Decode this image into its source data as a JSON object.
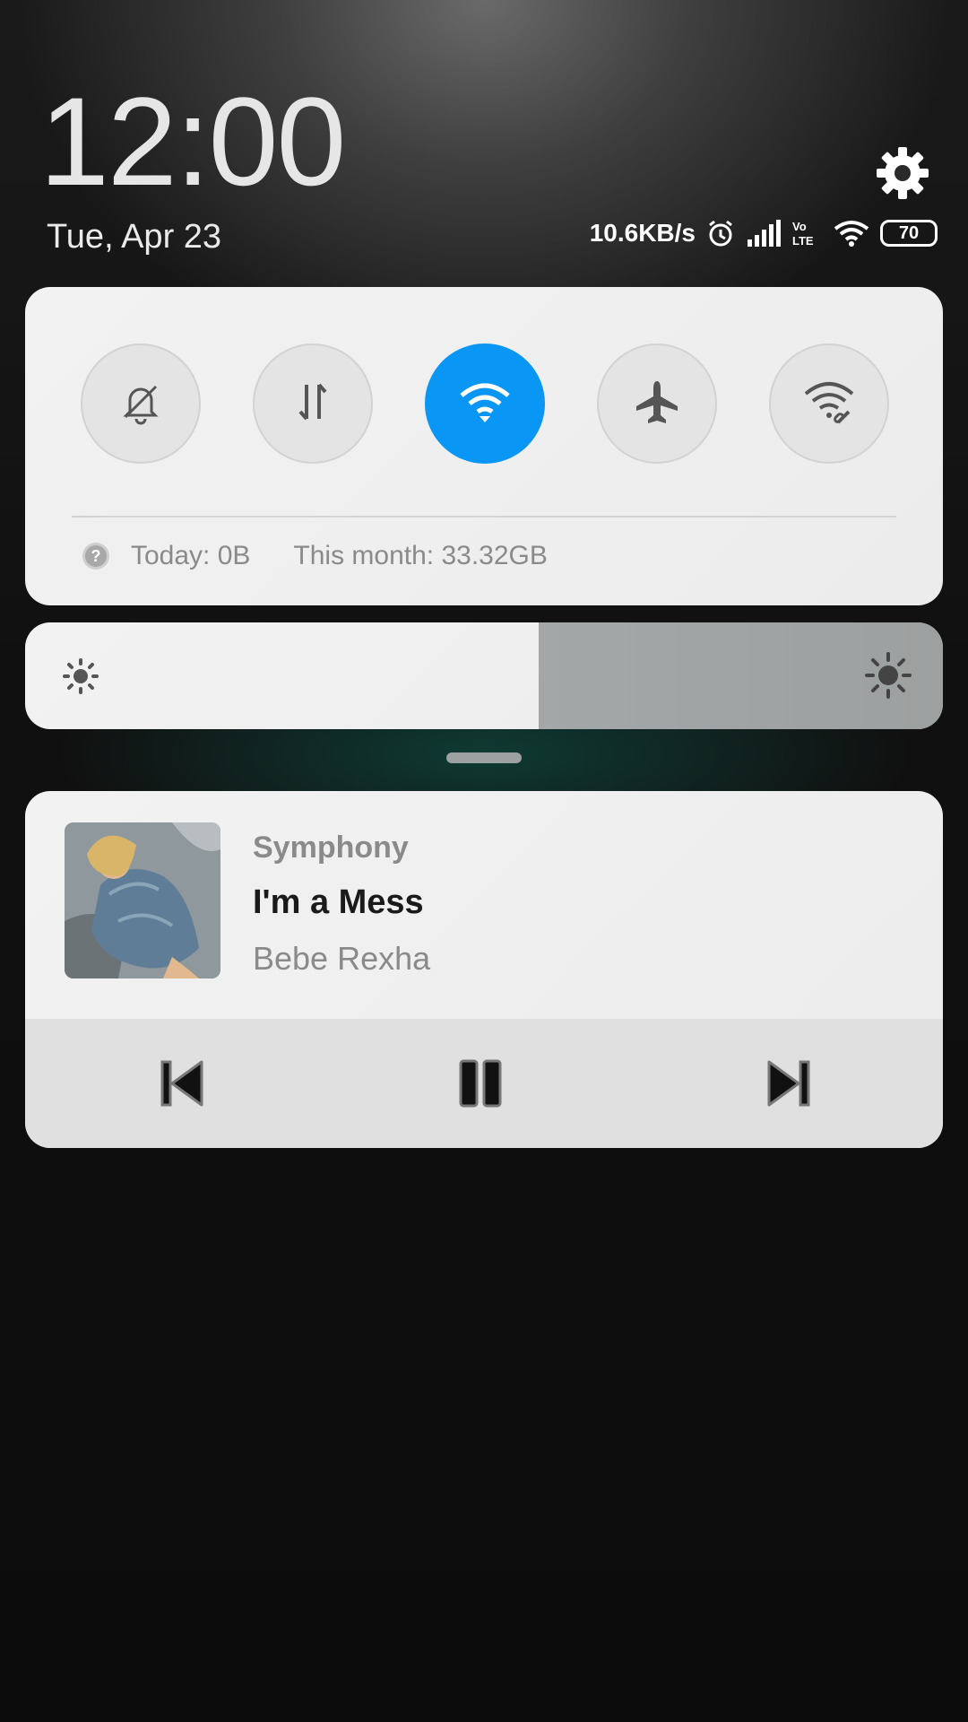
{
  "lockscreen": {
    "time": "12:00",
    "date": "Tue, Apr 23"
  },
  "status": {
    "net_speed": "10.6KB/s",
    "battery": "70",
    "icons": [
      "alarm-icon",
      "signal-icon",
      "volte-icon",
      "wifi-icon",
      "battery-icon"
    ]
  },
  "quick_toggles": [
    {
      "name": "silent",
      "icon": "bell-off-icon",
      "active": false
    },
    {
      "name": "mobile-data",
      "icon": "data-transfer-icon",
      "active": false
    },
    {
      "name": "wifi",
      "icon": "wifi-icon",
      "active": true
    },
    {
      "name": "airplane-mode",
      "icon": "airplane-icon",
      "active": false
    },
    {
      "name": "hotspot",
      "icon": "wifi-link-icon",
      "active": false
    }
  ],
  "data_usage": {
    "today": "Today: 0B",
    "month": "This month: 33.32GB"
  },
  "brightness": {
    "level": 0.56
  },
  "media": {
    "app": "Symphony",
    "title": "I'm a Mess",
    "artist": "Bebe Rexha",
    "controls": [
      "previous-icon",
      "pause-icon",
      "next-icon"
    ]
  },
  "colors": {
    "accent": "#0a96f5",
    "panel": "#efefef"
  }
}
